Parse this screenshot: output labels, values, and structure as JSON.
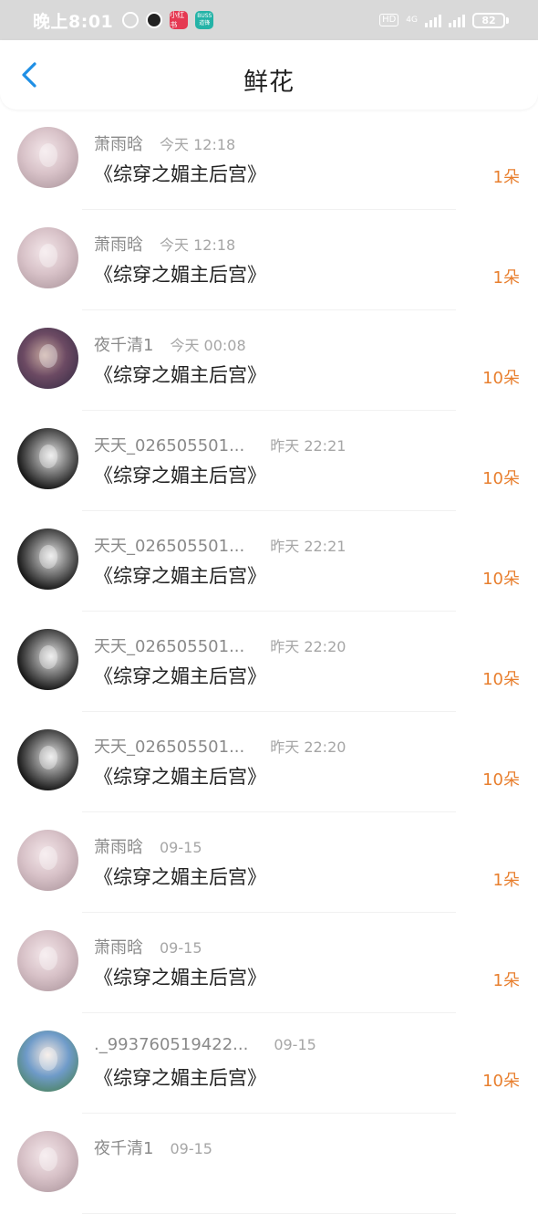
{
  "status_bar": {
    "time": "晚上8:01",
    "app_icon_red": "小红书",
    "app_icon_teal": "BUSS 道锋",
    "hd": "HD",
    "network": "4G",
    "battery": "82"
  },
  "header": {
    "title": "鲜花",
    "back_icon": "chevron-left-icon"
  },
  "colors": {
    "accent": "#1f8fe5",
    "count": "#e87f2e"
  },
  "items": [
    {
      "name": "萧雨晗",
      "time": "今天 12:18",
      "book": "《综穿之媚主后宫》",
      "count": "1朵",
      "avatar": "pink"
    },
    {
      "name": "萧雨晗",
      "time": "今天 12:18",
      "book": "《综穿之媚主后宫》",
      "count": "1朵",
      "avatar": "pink"
    },
    {
      "name": "夜千清1",
      "time": "今天 00:08",
      "book": "《综穿之媚主后宫》",
      "count": "10朵",
      "avatar": "purple"
    },
    {
      "name": "天天_026505501...",
      "time": "昨天 22:21",
      "book": "《综穿之媚主后宫》",
      "count": "10朵",
      "avatar": "bw"
    },
    {
      "name": "天天_026505501...",
      "time": "昨天 22:21",
      "book": "《综穿之媚主后宫》",
      "count": "10朵",
      "avatar": "bw"
    },
    {
      "name": "天天_026505501...",
      "time": "昨天 22:20",
      "book": "《综穿之媚主后宫》",
      "count": "10朵",
      "avatar": "bw"
    },
    {
      "name": "天天_026505501...",
      "time": "昨天 22:20",
      "book": "《综穿之媚主后宫》",
      "count": "10朵",
      "avatar": "bw"
    },
    {
      "name": "萧雨晗",
      "time": "09-15",
      "book": "《综穿之媚主后宫》",
      "count": "1朵",
      "avatar": "pink"
    },
    {
      "name": "萧雨晗",
      "time": "09-15",
      "book": "《综穿之媚主后宫》",
      "count": "1朵",
      "avatar": "pink"
    },
    {
      "name": "._993760519422...",
      "time": "09-15",
      "book": "《综穿之媚主后宫》",
      "count": "10朵",
      "avatar": "green"
    },
    {
      "name": "夜千清1",
      "time": "09-15",
      "book": "",
      "count": "",
      "avatar": "pink"
    }
  ]
}
